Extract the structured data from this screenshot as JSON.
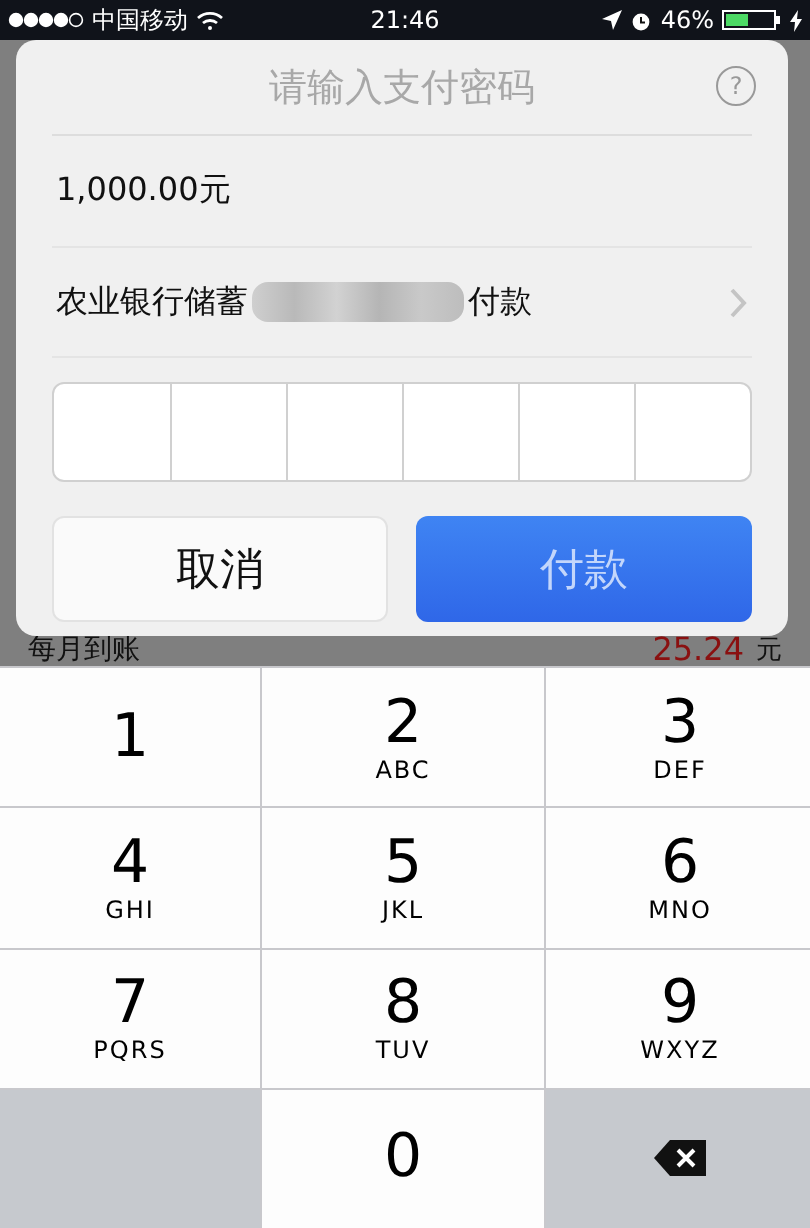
{
  "status_bar": {
    "carrier": "中国移动",
    "time": "21:46",
    "battery": "46%"
  },
  "background": {
    "label": "每月到账",
    "amount": "25.24",
    "unit": "元"
  },
  "dialog": {
    "title": "请输入支付密码",
    "help": "?",
    "amount": "1,000.00元",
    "payment_method": {
      "bank": "农业银行储蓄",
      "suffix": "付款"
    },
    "password_cells": [
      {
        "filled": false
      },
      {
        "filled": false
      },
      {
        "filled": false
      },
      {
        "filled": false
      },
      {
        "filled": false
      },
      {
        "filled": false
      }
    ],
    "buttons": [
      {
        "label": "取消",
        "kind": "cancel",
        "disabled": false
      },
      {
        "label": "付款",
        "kind": "confirm",
        "disabled": true
      }
    ]
  },
  "keypad": [
    {
      "kind": "digit",
      "digit": "1"
    },
    {
      "kind": "digit",
      "digit": "2",
      "letters": "ABC"
    },
    {
      "kind": "digit",
      "digit": "3",
      "letters": "DEF"
    },
    {
      "kind": "digit",
      "digit": "4",
      "letters": "GHI"
    },
    {
      "kind": "digit",
      "digit": "5",
      "letters": "JKL"
    },
    {
      "kind": "digit",
      "digit": "6",
      "letters": "MNO"
    },
    {
      "kind": "digit",
      "digit": "7",
      "letters": "PQRS"
    },
    {
      "kind": "digit",
      "digit": "8",
      "letters": "TUV"
    },
    {
      "kind": "digit",
      "digit": "9",
      "letters": "WXYZ"
    },
    {
      "kind": "blank"
    },
    {
      "kind": "digit",
      "digit": "0"
    },
    {
      "kind": "delete"
    }
  ]
}
